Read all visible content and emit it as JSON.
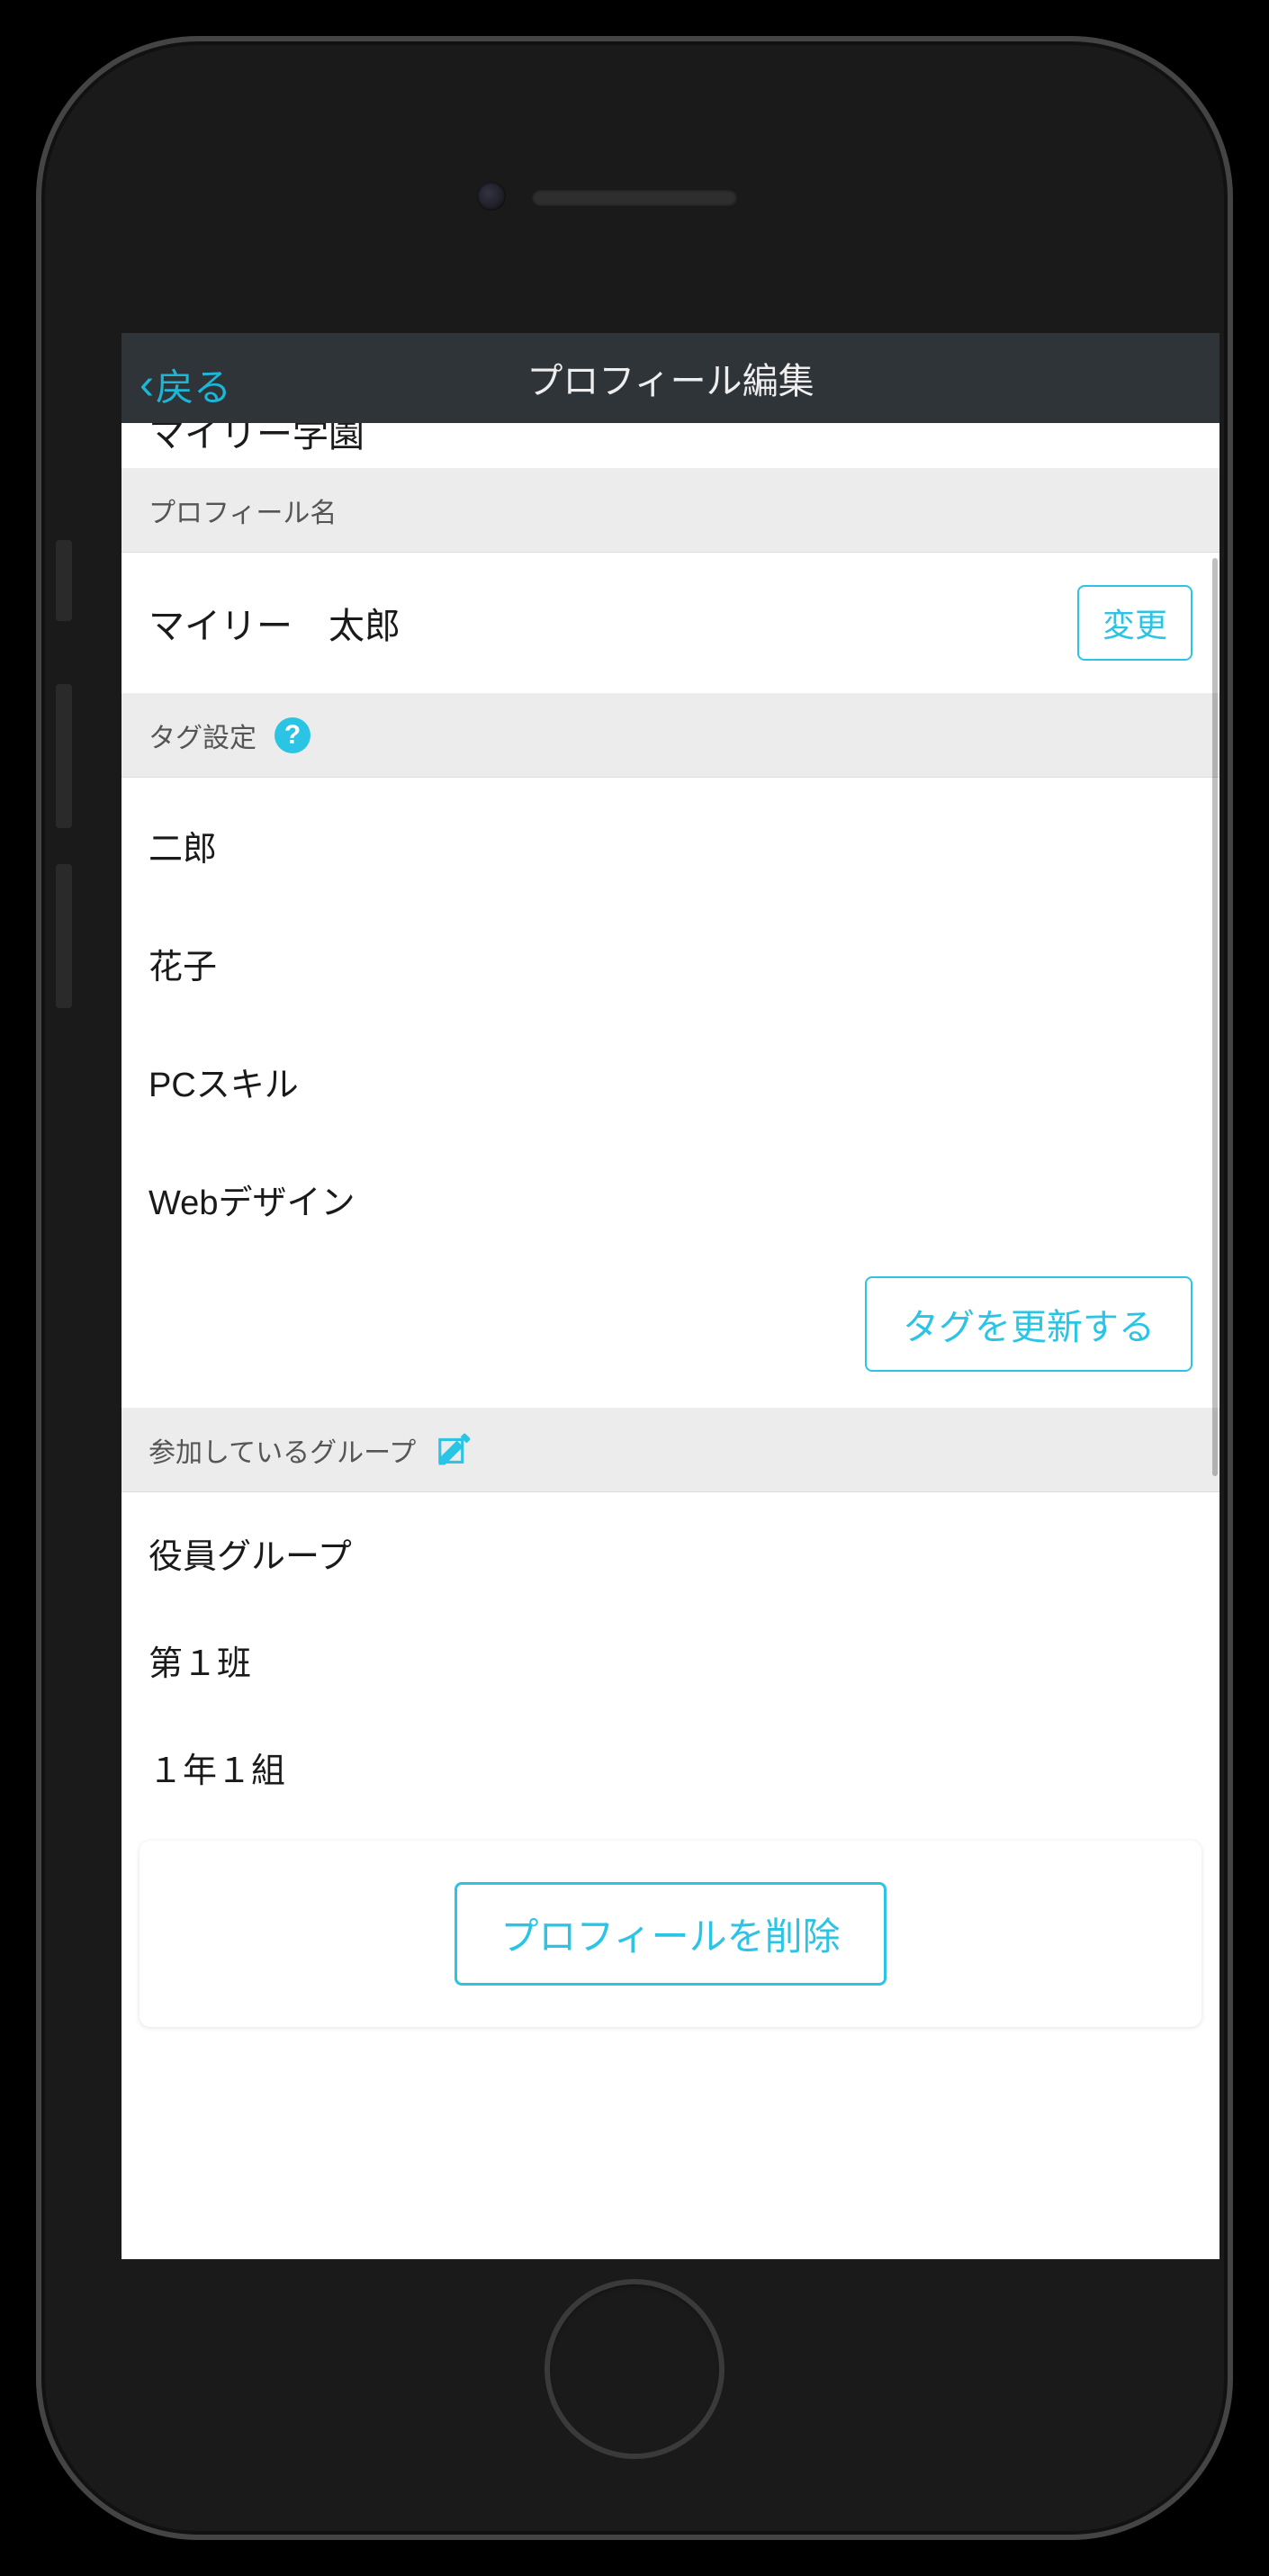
{
  "navbar": {
    "back_label": "戻る",
    "title": "プロフィール編集"
  },
  "clipped_school": "マイリー学園",
  "sections": {
    "profile_name_header": "プロフィール名",
    "tag_settings_header": "タグ設定",
    "groups_header": "参加しているグループ"
  },
  "profile": {
    "name": "マイリー　太郎",
    "change_label": "変更"
  },
  "tags": {
    "items": [
      "二郎",
      "花子",
      "PCスキル",
      "Webデザイン"
    ],
    "update_label": "タグを更新する"
  },
  "groups": {
    "items": [
      "役員グループ",
      "第１班",
      "１年１組"
    ]
  },
  "delete_label": "プロフィールを削除"
}
